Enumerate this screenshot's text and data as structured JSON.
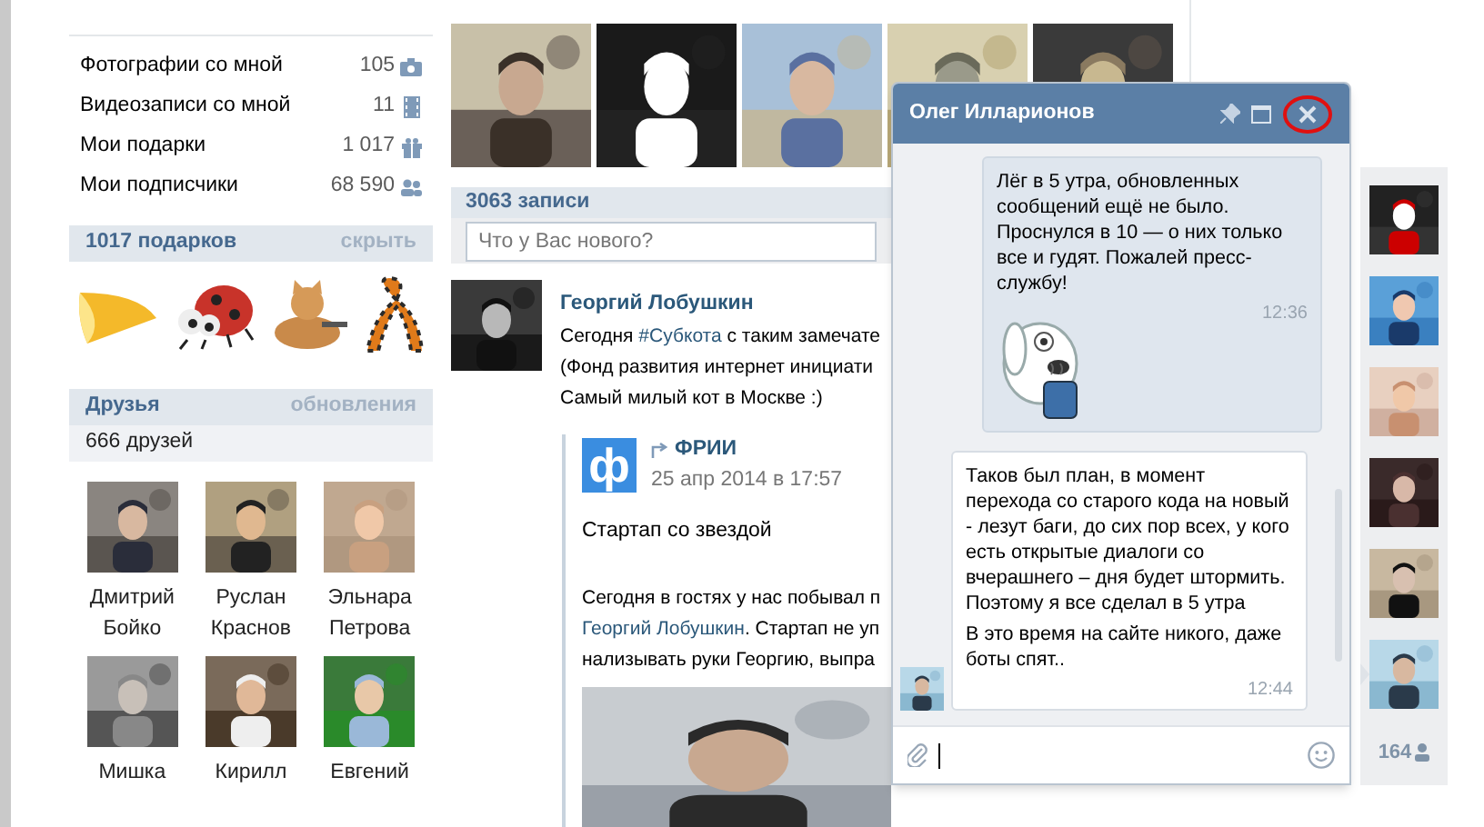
{
  "left_menu": [
    {
      "label": "Фотографии со мной",
      "count": "105",
      "kind": "photos"
    },
    {
      "label": "Видеозаписи со мной",
      "count": "11",
      "kind": "videos"
    },
    {
      "label": "Мои подарки",
      "count": "1 017",
      "kind": "gifts"
    },
    {
      "label": "Мои подписчики",
      "count": "68 590",
      "kind": "followers"
    }
  ],
  "gifts_section": {
    "title": "1017 подарков",
    "action": "скрыть"
  },
  "friends_section": {
    "title": "Друзья",
    "action": "обновления",
    "count": "666 друзей",
    "friends": [
      {
        "name": "Дмитрий Бойко"
      },
      {
        "name": "Руслан Краснов"
      },
      {
        "name": "Эльнара Петрова"
      },
      {
        "name": "Мишка"
      },
      {
        "name": "Кирилл"
      },
      {
        "name": "Евгений"
      }
    ]
  },
  "wall": {
    "title": "3063 записи",
    "composer": {
      "placeholder": "Что у Вас нового?"
    },
    "post": {
      "author": "Георгий Лобушкин",
      "lines": [
        [
          {
            "text": "Сегодня "
          },
          {
            "text": "#Субкота",
            "kind": "link"
          },
          {
            "text": " с таким замечате"
          }
        ],
        [
          {
            "text": "(Фонд развития интернет инициати"
          }
        ],
        [
          {
            "text": "Самый милый кот в Москве :)"
          }
        ]
      ],
      "repost": {
        "logo": "ф",
        "source": "ФРИИ",
        "date": "25 апр 2014 в 17:57",
        "title": "Стартап со звездой",
        "lines": [
          [
            {
              "text": "Сегодня в гостях у нас побывал п"
            }
          ],
          [
            {
              "text": "Георгий Лобушкин",
              "kind": "link"
            },
            {
              "text": ". Стартап не уп"
            }
          ],
          [
            {
              "text": "нализывать руки Георгию, выпра"
            }
          ]
        ]
      }
    }
  },
  "chat": {
    "title": "Олег Илларионов",
    "messages": [
      {
        "kind": "outgoing",
        "paragraphs": [
          "Лёг в 5 утра, обновленных сообщений ещё не было. Проснулся в 10 — о них только все и гудят. Пожалей пресс-службу!"
        ],
        "time": "12:36",
        "sticker": true
      },
      {
        "kind": "incoming",
        "paragraphs": [
          "Таков был план, в момент перехода со старого кода на новый - лезут баги, до сих пор всех, у кого есть открытые диалоги со вчерашнего – дня будет штормить. Поэтому я все сделал в 5 утра",
          "В это время на сайте никого, даже боты спят.."
        ],
        "time": "12:44",
        "sticker": false
      }
    ]
  },
  "dialogs": {
    "count": "164",
    "contacts": [
      {
        "selected": false
      },
      {
        "selected": false
      },
      {
        "selected": false
      },
      {
        "selected": false
      },
      {
        "selected": false
      },
      {
        "selected": true
      }
    ]
  }
}
